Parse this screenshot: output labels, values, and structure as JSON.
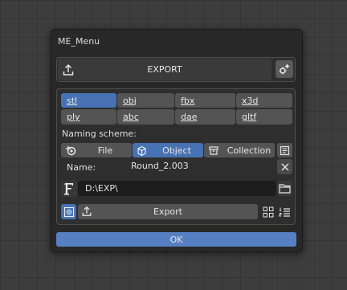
{
  "window": {
    "title": "ME_Menu"
  },
  "export_header": {
    "label": "EXPORT",
    "icon": "export-arrow-icon",
    "settings_icon": "settings-sparkle-icon"
  },
  "formats": {
    "items": [
      {
        "label": "stl",
        "selected": true
      },
      {
        "label": "obj",
        "selected": false
      },
      {
        "label": "fbx",
        "selected": false
      },
      {
        "label": "x3d",
        "selected": false
      },
      {
        "label": "ply",
        "selected": false
      },
      {
        "label": "abc",
        "selected": false
      },
      {
        "label": "dae",
        "selected": false
      },
      {
        "label": "gltf",
        "selected": false
      }
    ]
  },
  "naming": {
    "label": "Naming scheme:",
    "tabs": [
      {
        "label": "File",
        "icon": "blender-logo-icon",
        "selected": false
      },
      {
        "label": "Object",
        "icon": "cube-icon",
        "selected": true
      },
      {
        "label": "Collection",
        "icon": "collection-box-icon",
        "selected": false
      }
    ],
    "list_icon": "text-list-icon"
  },
  "name_row": {
    "label": "Name:",
    "value": "Round_2.003",
    "clear_icon": "close-x-icon"
  },
  "path_row": {
    "icon": "font-f-icon",
    "value": "D:\\EXP\\",
    "folder_icon": "folder-icon"
  },
  "bottom_row": {
    "label": "Export",
    "left_icon": "scene-toggle-icon",
    "export_icon": "export-arrow-icon",
    "grid_icon": "grid-view-icon",
    "list_icon": "numbered-list-icon"
  },
  "ok": {
    "label": "OK"
  },
  "colors": {
    "accent": "#4772b3",
    "ok_button": "#5680c2",
    "button": "#545454",
    "panel": "#2e2e2e",
    "field": "#1d1d1d"
  }
}
